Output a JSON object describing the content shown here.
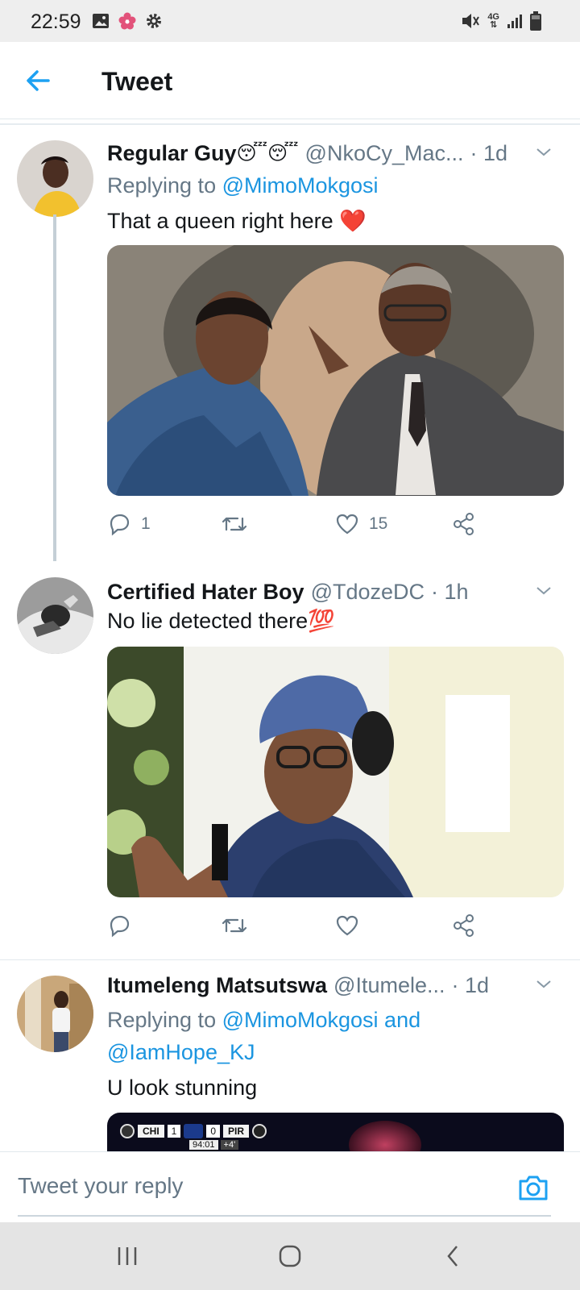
{
  "status_bar": {
    "time": "22:59",
    "left_icons": [
      "gallery-icon",
      "flower-icon",
      "gear-icon"
    ],
    "right_icons": [
      "mute-icon",
      "4g-icon",
      "signal-icon",
      "battery-icon"
    ],
    "network_label": "4G"
  },
  "header": {
    "title": "Tweet"
  },
  "tweets": [
    {
      "name": "Regular Guy",
      "name_emoji": "😴😴",
      "handle": "@NkoCy_Mac...",
      "time": "· 1d",
      "replying_prefix": "Replying to",
      "replying_to": "@MimoMokgosi",
      "text": "That a queen right here ❤️",
      "actions": {
        "reply_count": "1",
        "retweet_count": "",
        "like_count": "15"
      }
    },
    {
      "name": "Certified Hater Boy",
      "handle": "@TdozeDC",
      "time": "· 1h",
      "text": "No lie detected there💯",
      "actions": {
        "reply_count": "",
        "retweet_count": "",
        "like_count": ""
      }
    },
    {
      "name": "Itumeleng Matsutswa",
      "handle": "@Itumele...",
      "time": "· 1d",
      "replying_prefix": "Replying to",
      "replying_to": "@MimoMokgosi and",
      "replying_to_2": "@IamHope_KJ",
      "text": "U look stunning",
      "scoreboard": {
        "home": "CHI",
        "home_score": "1",
        "away_score": "0",
        "away": "PIR",
        "clock": "94:01",
        "added": "+4'"
      }
    }
  ],
  "reply_bar": {
    "placeholder": "Tweet your reply"
  },
  "colors": {
    "accent": "#1da1f2",
    "mention": "#1b95e0",
    "muted": "#657786",
    "heart": "#e0245e"
  }
}
